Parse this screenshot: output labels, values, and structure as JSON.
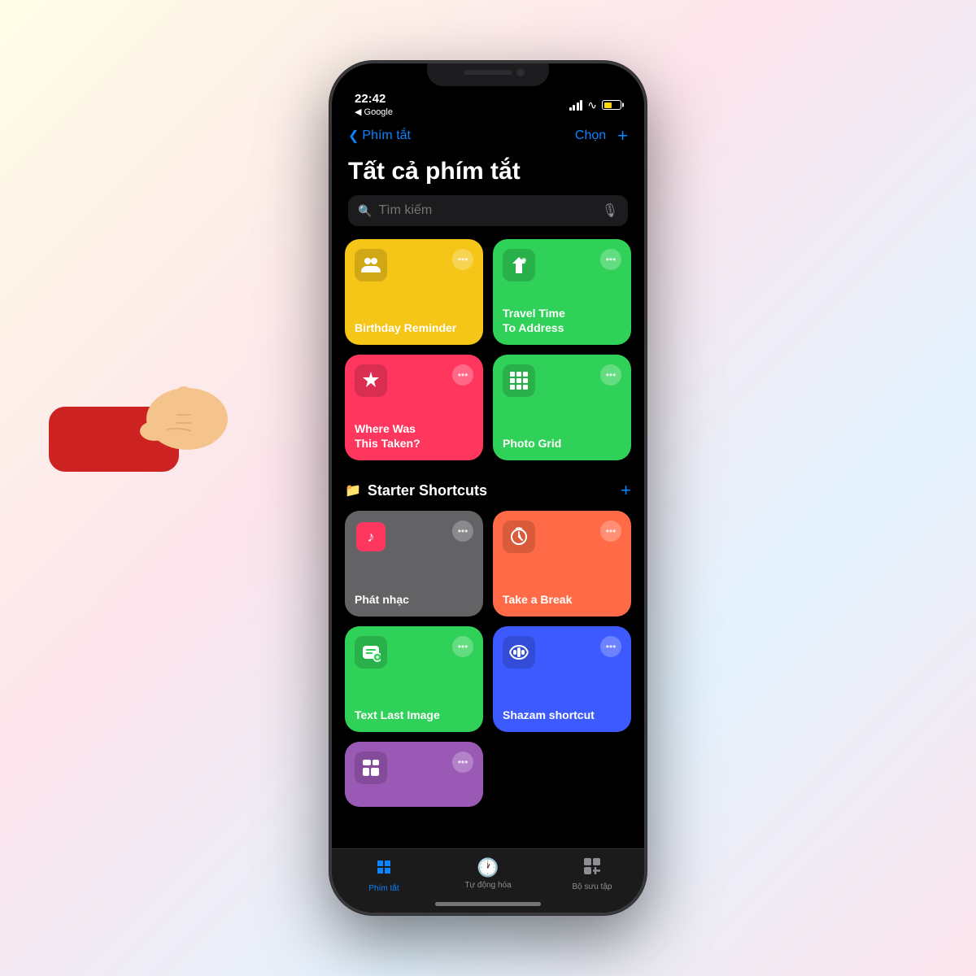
{
  "background": {
    "gradient": "linear-gradient(135deg, #fffde7, #fce4ec, #e3f2fd)"
  },
  "statusBar": {
    "time": "22:42",
    "backApp": "◀ Google",
    "carrier": "signal"
  },
  "navBar": {
    "backLabel": "Phím tắt",
    "chooseLabel": "Chọn",
    "addLabel": "+"
  },
  "pageTitle": "Tất cả phím tắt",
  "searchPlaceholder": "Tìm kiếm",
  "shortcuts": [
    {
      "id": "birthday",
      "label": "Birthday Reminder",
      "color": "#f5c518",
      "iconType": "people"
    },
    {
      "id": "travel",
      "label": "Travel Time To Address",
      "color": "#30d158",
      "iconType": "wand"
    },
    {
      "id": "where",
      "label": "Where Was This Taken?",
      "color": "#ff375f",
      "iconType": "wand"
    },
    {
      "id": "photo",
      "label": "Photo Grid",
      "color": "#30d158",
      "iconType": "grid"
    }
  ],
  "starterSection": {
    "title": "Starter Shortcuts",
    "addLabel": "+"
  },
  "starterShortcuts": [
    {
      "id": "music",
      "label": "Phát nhạc",
      "color": "#636366",
      "iconType": "music"
    },
    {
      "id": "break",
      "label": "Take a Break",
      "color": "#ff6b47",
      "iconType": "timer"
    },
    {
      "id": "text",
      "label": "Text Last Image",
      "color": "#30d158",
      "iconType": "message"
    },
    {
      "id": "shazam",
      "label": "Shazam shortcut",
      "color": "#3d5afe",
      "iconType": "wave"
    },
    {
      "id": "purple",
      "label": "",
      "color": "#9b59b6",
      "iconType": "layers"
    }
  ],
  "tabBar": {
    "tabs": [
      {
        "id": "shortcuts",
        "label": "Phím tắt",
        "active": true,
        "iconType": "shortcuts"
      },
      {
        "id": "automation",
        "label": "Tự động hóa",
        "active": false,
        "iconType": "clock"
      },
      {
        "id": "gallery",
        "label": "Bộ sưu tập",
        "active": false,
        "iconType": "gallery"
      }
    ]
  },
  "moreButton": "•••"
}
